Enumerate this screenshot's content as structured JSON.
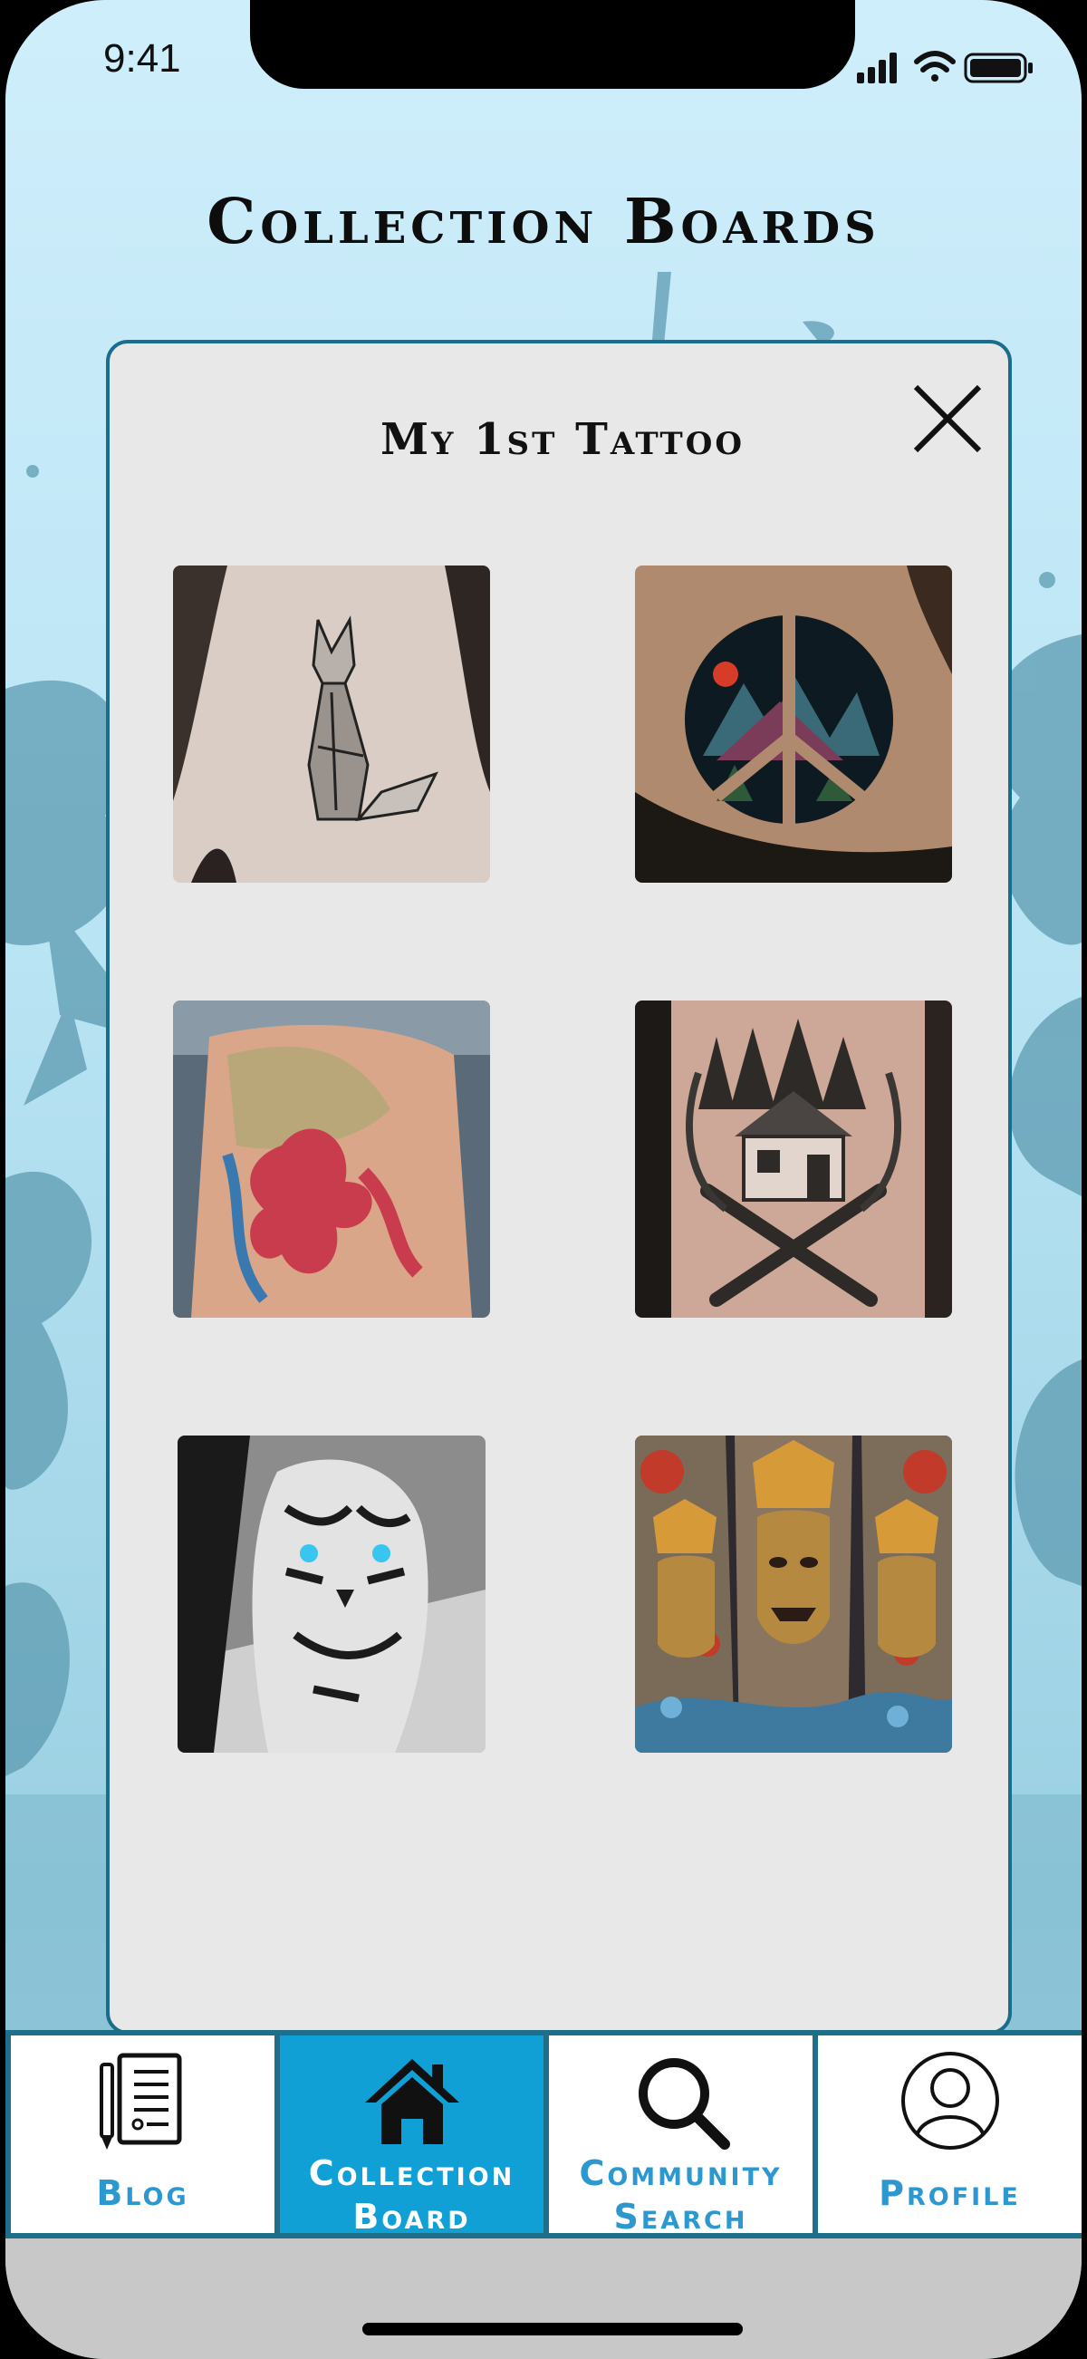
{
  "status_bar": {
    "time": "9:41"
  },
  "page": {
    "title": "Collection Boards"
  },
  "board": {
    "title": "My 1st Tattoo",
    "close_icon": "close-icon",
    "images": [
      {
        "name": "geometric-fox-back-tattoo"
      },
      {
        "name": "peace-sign-mountain-tattoo"
      },
      {
        "name": "octopus-ship-back-tattoo"
      },
      {
        "name": "cabin-axes-tattoo"
      },
      {
        "name": "blue-eyed-tiger-tattoo"
      },
      {
        "name": "samurai-mask-sleeve-tattoo"
      }
    ]
  },
  "tabs": [
    {
      "label_line1": "Blog",
      "label_line2": "",
      "icon": "document-pen-icon",
      "active": false
    },
    {
      "label_line1": "Collection",
      "label_line2": "Board",
      "icon": "home-icon",
      "active": true
    },
    {
      "label_line1": "Community",
      "label_line2": "Search",
      "icon": "search-icon",
      "active": false
    },
    {
      "label_line1": "Profile",
      "label_line2": "",
      "icon": "user-circle-icon",
      "active": false
    }
  ],
  "colors": {
    "accent": "#10a0d6",
    "tab_label": "#2d97cf",
    "modal_border": "#1a6d8c",
    "modal_bg": "#e8e8e8"
  }
}
